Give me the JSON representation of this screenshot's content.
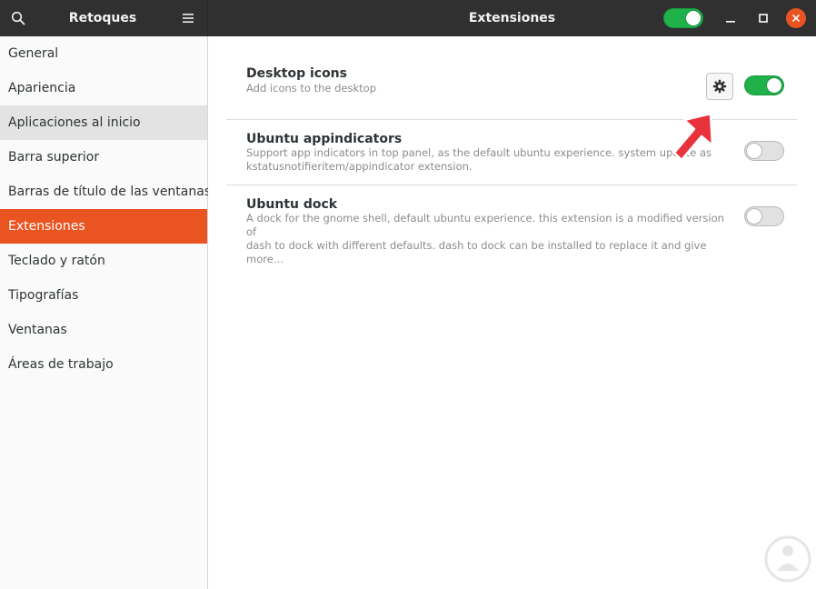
{
  "header": {
    "app_title": "Retoques",
    "page_title": "Extensiones",
    "extensions_enabled": true
  },
  "sidebar": {
    "items": [
      {
        "label": "General"
      },
      {
        "label": "Apariencia"
      },
      {
        "label": "Aplicaciones al inicio"
      },
      {
        "label": "Barra superior"
      },
      {
        "label": "Barras de título de las ventanas"
      },
      {
        "label": "Extensiones"
      },
      {
        "label": "Teclado y ratón"
      },
      {
        "label": "Tipografías"
      },
      {
        "label": "Ventanas"
      },
      {
        "label": "Áreas de trabajo"
      }
    ],
    "selected": "Extensiones"
  },
  "extensions": [
    {
      "name": "Desktop icons",
      "desc_line1": "Add icons to the desktop",
      "desc_line2": "",
      "enabled": true,
      "has_settings": true
    },
    {
      "name": "Ubuntu appindicators",
      "desc_line1": "Support app indicators in top panel, as the default ubuntu experience. system update as",
      "desc_line2": "kstatusnotifieritem/appindicator extension.",
      "enabled": false,
      "has_settings": false
    },
    {
      "name": "Ubuntu dock",
      "desc_line1": "A dock for the gnome shell, default ubuntu experience. this extension is a modified version of",
      "desc_line2": "dash to dock with different defaults. dash to dock can be installed to replace it and give more…",
      "enabled": false,
      "has_settings": false
    }
  ],
  "colors": {
    "accent": "#e95420",
    "switch_on": "#1fb24a",
    "headerbar": "#303030",
    "arrow": "#e8333c"
  },
  "icons": {
    "search": "search-icon",
    "menu": "hamburger-menu-icon",
    "minimize": "minimize-icon",
    "maximize": "maximize-icon",
    "close": "close-icon",
    "settings": "gear-icon"
  }
}
